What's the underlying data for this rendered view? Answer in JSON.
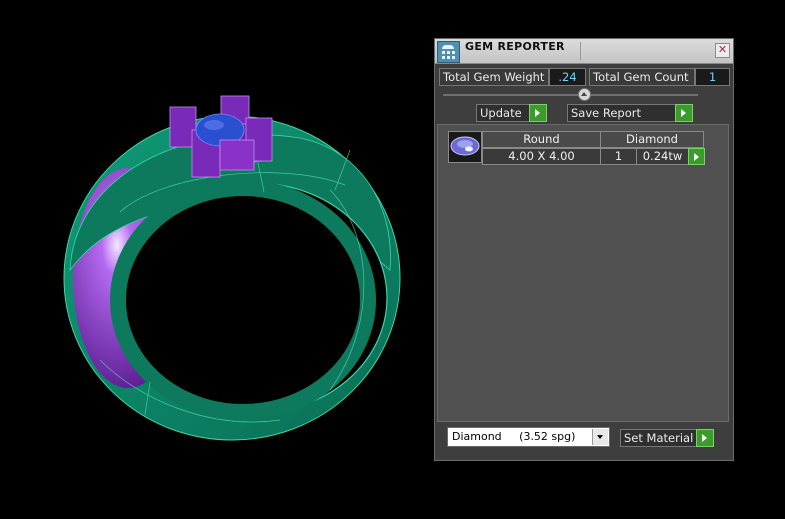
{
  "panel": {
    "title": "GEM REPORTER",
    "close_glyph": "✕",
    "stats": {
      "weight_label": "Total Gem Weight",
      "weight_value": ".24",
      "count_label": "Total Gem Count",
      "count_value": "1"
    },
    "buttons": {
      "update": "Update",
      "save_report": "Save Report",
      "set_material": "Set Material"
    },
    "gem_rows": [
      {
        "icon": "round-gem-icon",
        "shape": "Round",
        "material": "Diamond",
        "size": "4.00 X 4.00",
        "quantity": "1",
        "weight": "0.24tw"
      }
    ],
    "material_select": {
      "value": "Diamond     (3.52 spg)"
    }
  },
  "viewport": {
    "metal_color": "#0e8a6a",
    "inner_color": "#8a32c8",
    "gem_color": "#2a4fd0",
    "prong_color": "#7a2ab8"
  }
}
